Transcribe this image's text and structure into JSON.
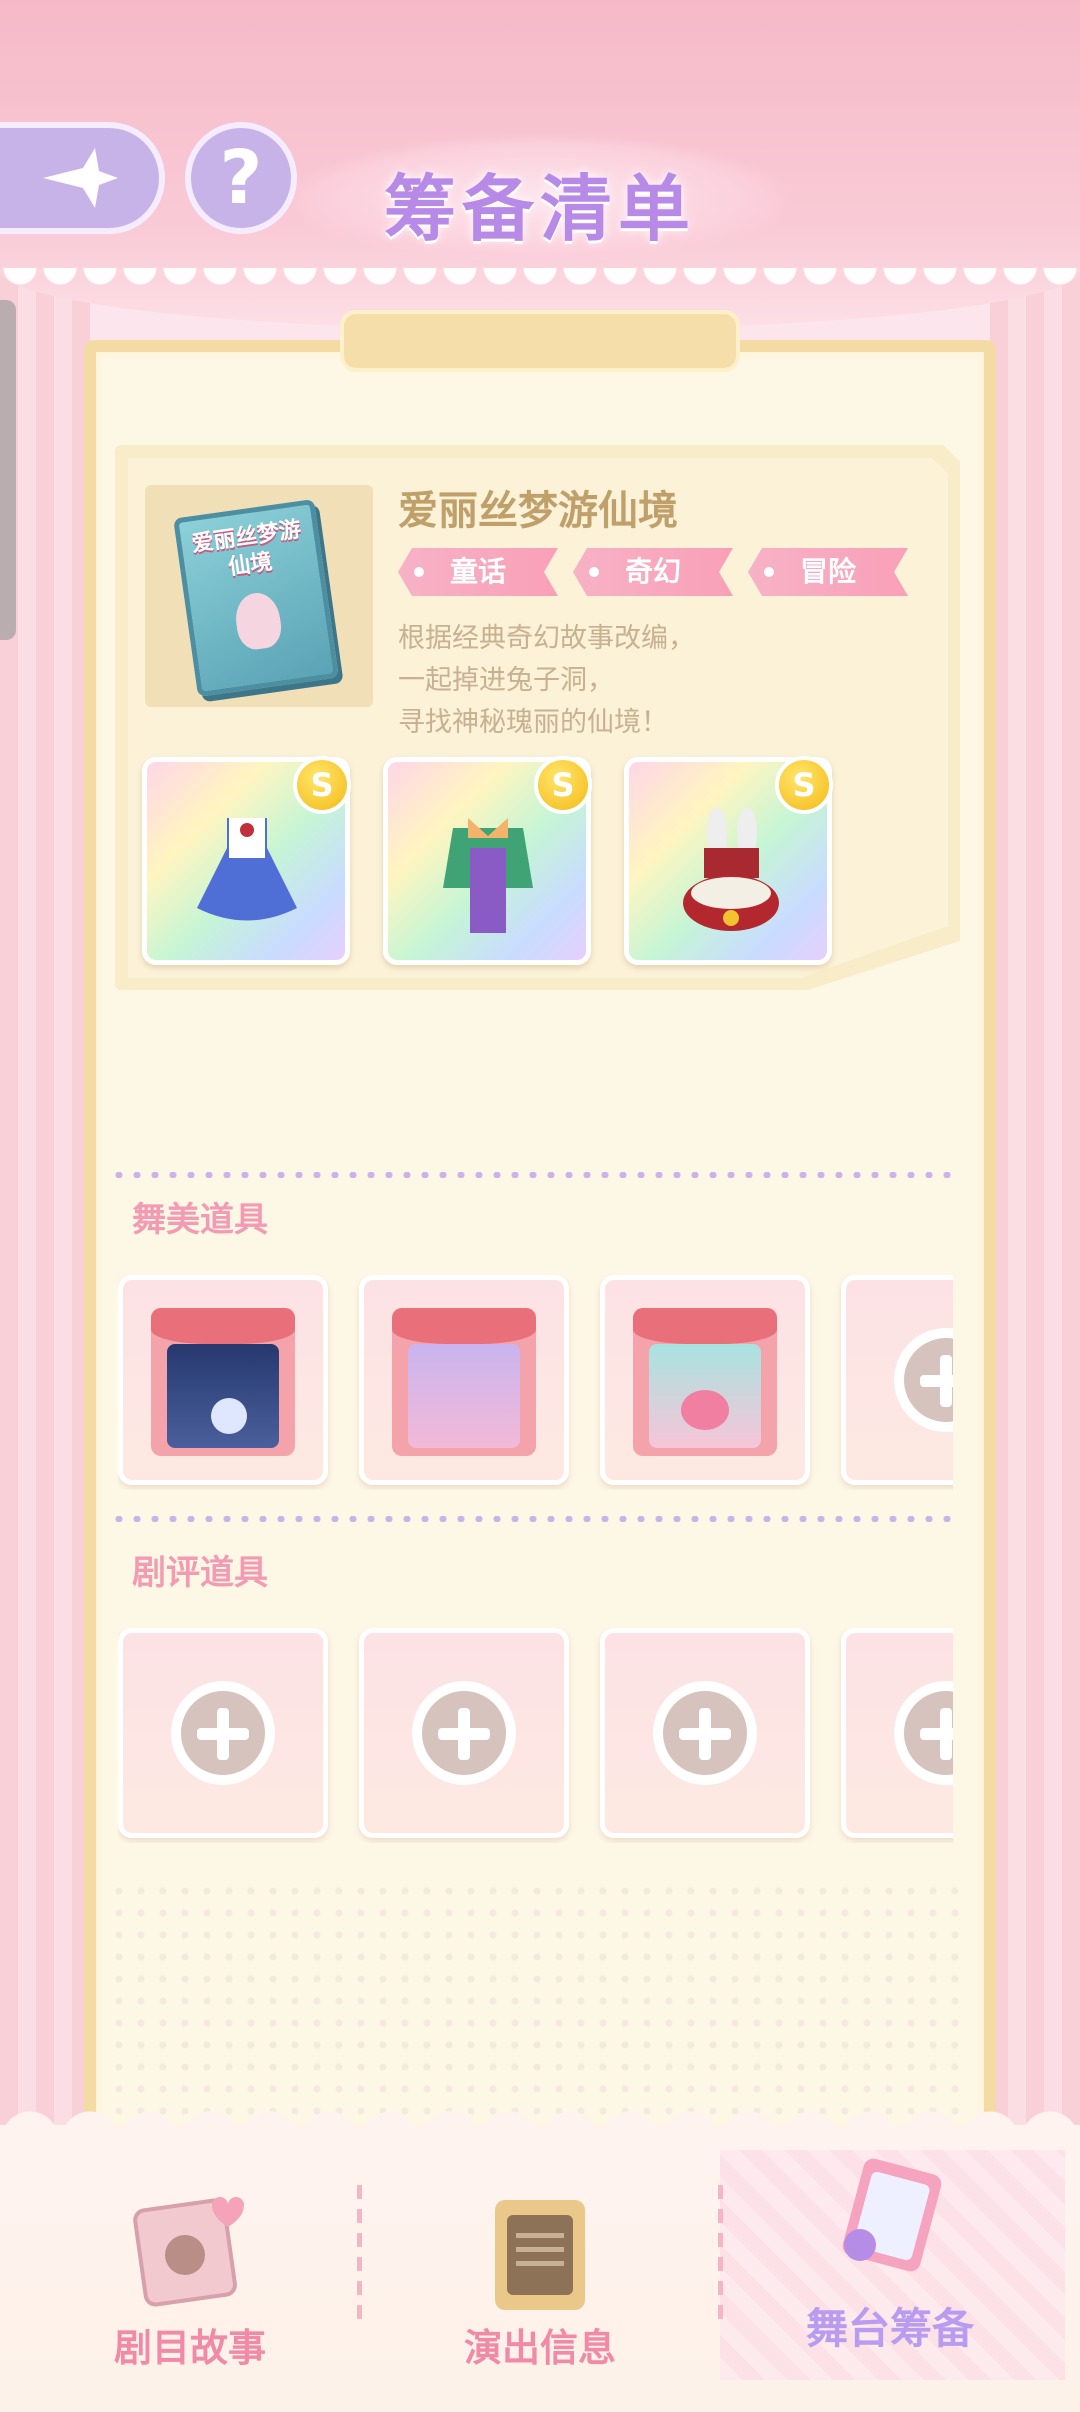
{
  "header": {
    "title": "筹备清单"
  },
  "story": {
    "cover_text": "爱丽丝梦游仙境",
    "title": "爱丽丝梦游仙境",
    "tags": [
      "童话",
      "奇幻",
      "冒险"
    ],
    "description": [
      "根据经典奇幻故事改编，",
      "一起掉进兔子洞，",
      "寻找神秘瑰丽的仙境！"
    ],
    "items": [
      {
        "name": "blue-maid-dress",
        "rank": "S"
      },
      {
        "name": "green-purple-suit",
        "rank": "S"
      },
      {
        "name": "rabbit-hat-clock",
        "rank": "S"
      }
    ]
  },
  "sections": {
    "stage_props": {
      "label": "舞美道具"
    },
    "review_props": {
      "label": "剧评道具"
    }
  },
  "nav": {
    "tabs": [
      {
        "label": "剧目故事",
        "icon": "book-icon"
      },
      {
        "label": "演出信息",
        "icon": "board-icon"
      },
      {
        "label": "舞台筹备",
        "icon": "clipboard-icon",
        "active": true
      }
    ]
  },
  "colors": {
    "accent_purple": "#b88ae8",
    "accent_pink": "#f29bb3",
    "gold": "#f4b917"
  }
}
